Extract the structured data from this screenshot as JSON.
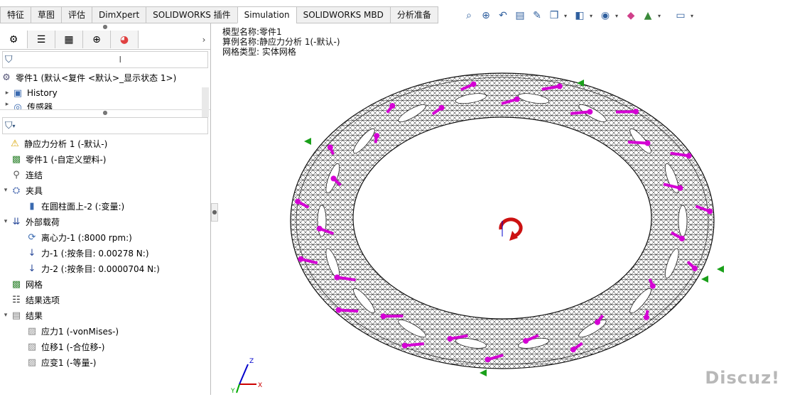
{
  "tabs": [
    "特征",
    "草图",
    "评估",
    "DimXpert",
    "SOLIDWORKS 插件",
    "Simulation",
    "SOLIDWORKS MBD",
    "分析准备"
  ],
  "active_tab": "Simulation",
  "toolbar_icons": [
    "zoom-to-fit-icon",
    "zoom-area-icon",
    "previous-view-icon",
    "section-view-icon",
    "dynamic-annotation-icon",
    "view-orientation-icon",
    "display-style-icon",
    "hide-show-icon",
    "edit-appearance-icon",
    "apply-scene-icon",
    "view-settings-icon"
  ],
  "feature_tree": {
    "part_label": "零件1 (默认<复件 <默认>_显示状态 1>)",
    "history_label": "History",
    "sensors_label": "传感器"
  },
  "study_tree": {
    "items": [
      {
        "label": "静应力分析 1 (-默认-)",
        "icon": "warning-study-icon",
        "indent": 0,
        "expander": ""
      },
      {
        "label": "零件1 (-自定义塑料-)",
        "icon": "part-icon",
        "indent": 1,
        "expander": ""
      },
      {
        "label": "连结",
        "icon": "connections-icon",
        "indent": 1,
        "expander": ""
      },
      {
        "label": "夹具",
        "icon": "fixtures-icon",
        "indent": 1,
        "expander": "▾"
      },
      {
        "label": "在圆柱面上-2 (:变量:)",
        "icon": "fixture-item-icon",
        "indent": 2,
        "expander": ""
      },
      {
        "label": "外部载荷",
        "icon": "external-loads-icon",
        "indent": 1,
        "expander": "▾"
      },
      {
        "label": "离心力-1 (:8000 rpm:)",
        "icon": "centrifugal-icon",
        "indent": 2,
        "expander": ""
      },
      {
        "label": "力-1 (:按条目: 0.00278 N:)",
        "icon": "force-icon",
        "indent": 2,
        "expander": ""
      },
      {
        "label": "力-2 (:按条目: 0.0000704 N:)",
        "icon": "force-icon",
        "indent": 2,
        "expander": ""
      },
      {
        "label": "网格",
        "icon": "mesh-icon",
        "indent": 1,
        "expander": ""
      },
      {
        "label": "结果选项",
        "icon": "result-options-icon",
        "indent": 1,
        "expander": ""
      },
      {
        "label": "结果",
        "icon": "results-folder-icon",
        "indent": 1,
        "expander": "▾"
      },
      {
        "label": "应力1 (-vonMises-)",
        "icon": "plot-icon",
        "indent": 2,
        "expander": ""
      },
      {
        "label": "位移1 (-合位移-)",
        "icon": "plot-icon",
        "indent": 2,
        "expander": ""
      },
      {
        "label": "应变1 (-等量-)",
        "icon": "plot-icon",
        "indent": 2,
        "expander": ""
      }
    ]
  },
  "viewport_info": {
    "model_name": "模型名称:零件1",
    "study_name": "算例名称:静应力分析 1(-默认-)",
    "mesh_type": "网格类型: 实体网格"
  },
  "triad_labels": {
    "x": "X",
    "y": "Y",
    "z": "Z"
  },
  "watermark": "Discuz!",
  "colors": {
    "load_arrow": "#d400d4",
    "fixture_arrow": "#1aa01a",
    "mesh_line": "#111111",
    "centrifugal": "#cc1111",
    "axis_x": "#cc0000",
    "axis_y": "#00aa00",
    "axis_z": "#0000cc"
  }
}
